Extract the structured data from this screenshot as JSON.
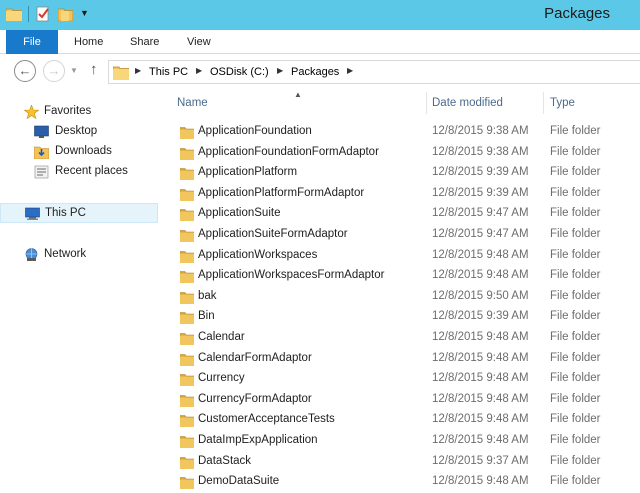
{
  "window": {
    "title": "Packages"
  },
  "ribbon": {
    "file": "File",
    "home": "Home",
    "share": "Share",
    "view": "View"
  },
  "address": {
    "crumbs": [
      "This PC",
      "OSDisk (C:)",
      "Packages"
    ]
  },
  "nav": {
    "favorites": "Favorites",
    "desktop": "Desktop",
    "downloads": "Downloads",
    "recent": "Recent places",
    "thispc": "This PC",
    "network": "Network"
  },
  "columns": {
    "name": "Name",
    "date": "Date modified",
    "type": "Type"
  },
  "files": [
    {
      "name": "ApplicationFoundation",
      "date": "12/8/2015 9:38 AM",
      "type": "File folder"
    },
    {
      "name": "ApplicationFoundationFormAdaptor",
      "date": "12/8/2015 9:38 AM",
      "type": "File folder"
    },
    {
      "name": "ApplicationPlatform",
      "date": "12/8/2015 9:39 AM",
      "type": "File folder"
    },
    {
      "name": "ApplicationPlatformFormAdaptor",
      "date": "12/8/2015 9:39 AM",
      "type": "File folder"
    },
    {
      "name": "ApplicationSuite",
      "date": "12/8/2015 9:47 AM",
      "type": "File folder"
    },
    {
      "name": "ApplicationSuiteFormAdaptor",
      "date": "12/8/2015 9:47 AM",
      "type": "File folder"
    },
    {
      "name": "ApplicationWorkspaces",
      "date": "12/8/2015 9:48 AM",
      "type": "File folder"
    },
    {
      "name": "ApplicationWorkspacesFormAdaptor",
      "date": "12/8/2015 9:48 AM",
      "type": "File folder"
    },
    {
      "name": "bak",
      "date": "12/8/2015 9:50 AM",
      "type": "File folder"
    },
    {
      "name": "Bin",
      "date": "12/8/2015 9:39 AM",
      "type": "File folder"
    },
    {
      "name": "Calendar",
      "date": "12/8/2015 9:48 AM",
      "type": "File folder"
    },
    {
      "name": "CalendarFormAdaptor",
      "date": "12/8/2015 9:48 AM",
      "type": "File folder"
    },
    {
      "name": "Currency",
      "date": "12/8/2015 9:48 AM",
      "type": "File folder"
    },
    {
      "name": "CurrencyFormAdaptor",
      "date": "12/8/2015 9:48 AM",
      "type": "File folder"
    },
    {
      "name": "CustomerAcceptanceTests",
      "date": "12/8/2015 9:48 AM",
      "type": "File folder"
    },
    {
      "name": "DataImpExpApplication",
      "date": "12/8/2015 9:48 AM",
      "type": "File folder"
    },
    {
      "name": "DataStack",
      "date": "12/8/2015 9:37 AM",
      "type": "File folder"
    },
    {
      "name": "DemoDataSuite",
      "date": "12/8/2015 9:48 AM",
      "type": "File folder"
    }
  ],
  "colors": {
    "titlebar": "#5bc8e8",
    "file_tab": "#1979ca",
    "folder": "#e8b74c"
  }
}
